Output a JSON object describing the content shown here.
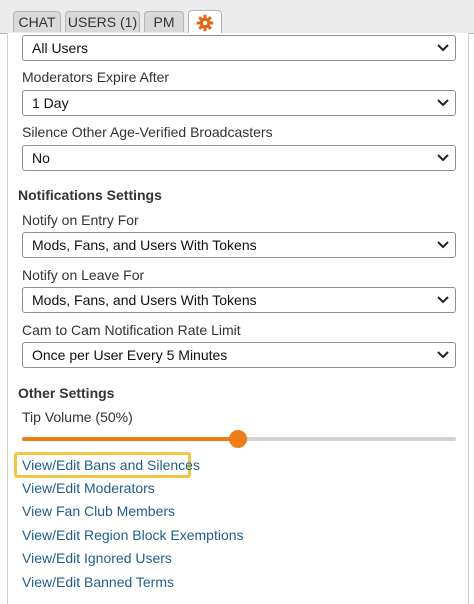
{
  "tabs": [
    {
      "label": "CHAT"
    },
    {
      "label": "USERS (1)"
    },
    {
      "label": "PM"
    },
    {
      "icon": "gear-icon"
    }
  ],
  "settings": {
    "top_select_value": "All Users",
    "moderators_expire": {
      "label": "Moderators Expire After",
      "value": "1 Day"
    },
    "silence_age_verified": {
      "label": "Silence Other Age-Verified Broadcasters",
      "value": "No"
    }
  },
  "notifications": {
    "title": "Notifications Settings",
    "entry": {
      "label": "Notify on Entry For",
      "value": "Mods, Fans, and Users With Tokens"
    },
    "leave": {
      "label": "Notify on Leave For",
      "value": "Mods, Fans, and Users With Tokens"
    },
    "cam_rate": {
      "label": "Cam to Cam Notification Rate Limit",
      "value": "Once per User Every 5 Minutes"
    }
  },
  "other": {
    "title": "Other Settings",
    "tip_volume_label": "Tip Volume (50%)",
    "tip_volume_value": 0.5,
    "links": [
      "View/Edit Bans and Silences",
      "View/Edit Moderators",
      "View Fan Club Members",
      "View/Edit Region Block Exemptions",
      "View/Edit Ignored Users",
      "View/Edit Banned Terms"
    ]
  },
  "colors": {
    "accent": "#f07c16",
    "link": "#1f5f8b",
    "highlight": "#f5c542"
  }
}
